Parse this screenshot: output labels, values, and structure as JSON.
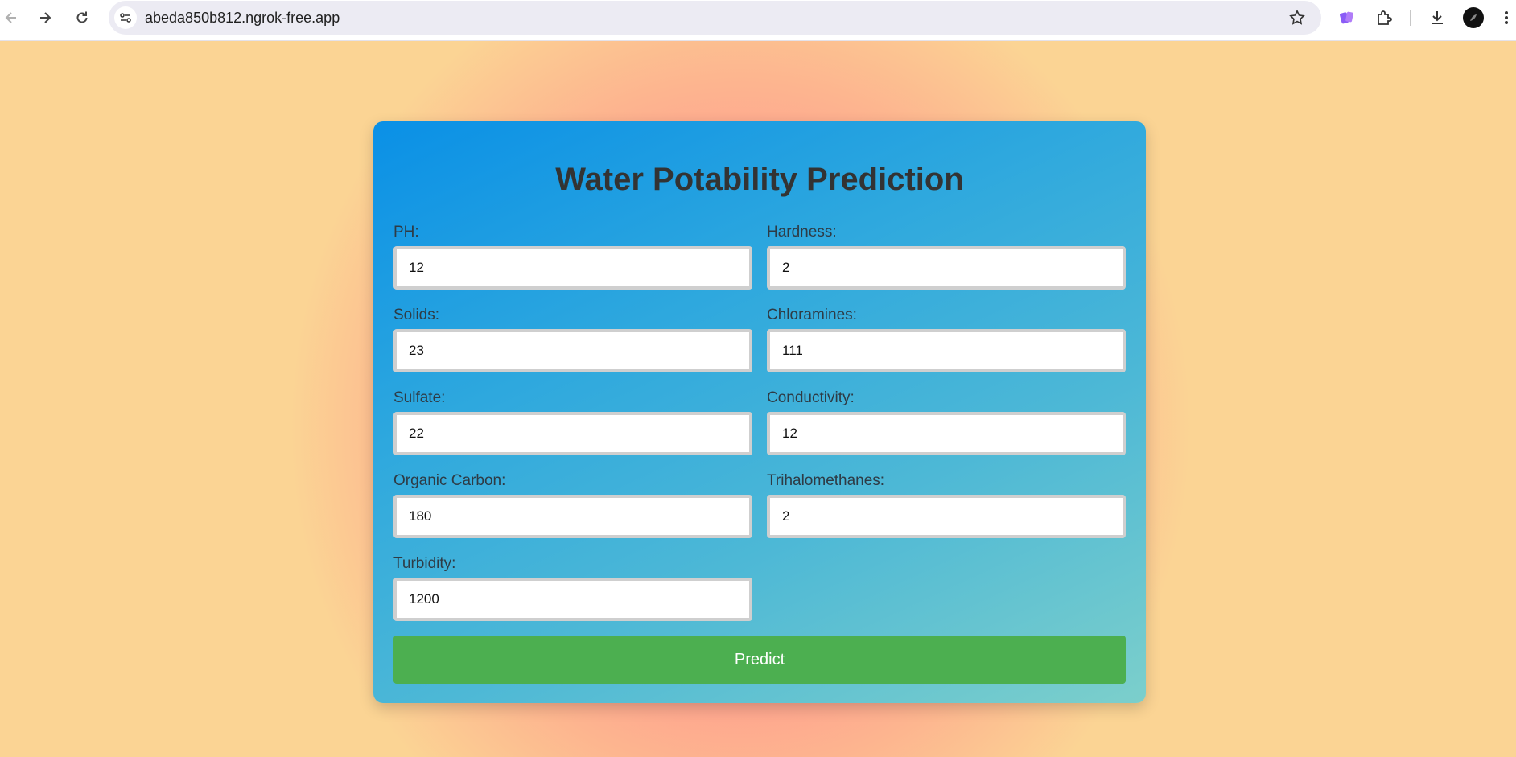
{
  "browser": {
    "url": "abeda850b812.ngrok-free.app"
  },
  "form": {
    "title": "Water Potability Prediction",
    "fields": [
      {
        "label": "PH:",
        "value": "12"
      },
      {
        "label": "Hardness:",
        "value": "2"
      },
      {
        "label": "Solids:",
        "value": "23"
      },
      {
        "label": "Chloramines:",
        "value": "111"
      },
      {
        "label": "Sulfate:",
        "value": "22"
      },
      {
        "label": "Conductivity:",
        "value": "12"
      },
      {
        "label": "Organic Carbon:",
        "value": "180"
      },
      {
        "label": "Trihalomethanes:",
        "value": "2"
      },
      {
        "label": "Turbidity:",
        "value": "1200"
      }
    ],
    "submit_label": "Predict"
  },
  "colors": {
    "card_top": "#0a90e6",
    "card_bottom": "#7ccfcb",
    "button": "#4caf50",
    "page_center": "#ff8e8e",
    "page_edge": "#fbd494"
  }
}
